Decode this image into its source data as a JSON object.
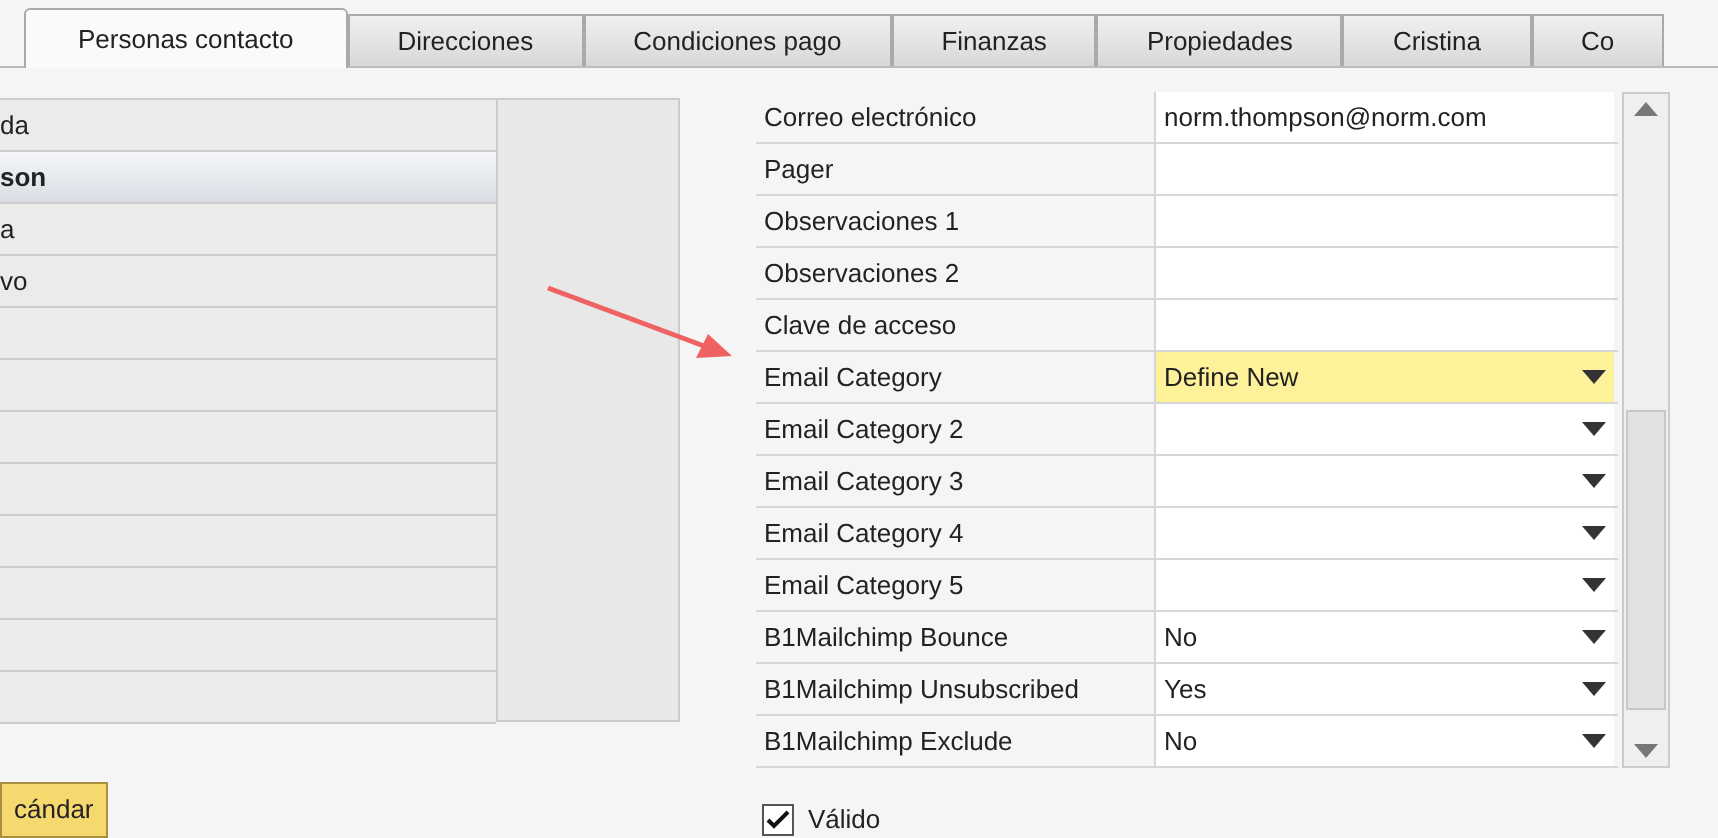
{
  "tabs": [
    {
      "label": "Personas contacto",
      "selected": true
    },
    {
      "label": "Direcciones",
      "selected": false
    },
    {
      "label": "Condiciones pago",
      "selected": false
    },
    {
      "label": "Finanzas",
      "selected": false
    },
    {
      "label": "Propiedades",
      "selected": false
    },
    {
      "label": "Cristina",
      "selected": false
    },
    {
      "label": "Co",
      "selected": false
    }
  ],
  "contacts": [
    {
      "name": "da",
      "selected": false
    },
    {
      "name": "son",
      "selected": true
    },
    {
      "name": "a",
      "selected": false
    },
    {
      "name": "vo",
      "selected": false
    }
  ],
  "fields": [
    {
      "label": "Correo electrónico",
      "kind": "text",
      "value": "norm.thompson@norm.com",
      "highlighted": false
    },
    {
      "label": "Pager",
      "kind": "text",
      "highlighted": false
    },
    {
      "label": "Observaciones 1",
      "kind": "text",
      "highlighted": false
    },
    {
      "label": "Observaciones 2",
      "kind": "text",
      "highlighted": false
    },
    {
      "label": "Clave de acceso",
      "kind": "text",
      "highlighted": false
    },
    {
      "label": "Email Category",
      "kind": "dropdown",
      "value": "Define New",
      "highlighted": true
    },
    {
      "label": "Email Category 2",
      "kind": "dropdown",
      "highlighted": false
    },
    {
      "label": "Email Category 3",
      "kind": "dropdown",
      "highlighted": false
    },
    {
      "label": "Email Category 4",
      "kind": "dropdown",
      "highlighted": false
    },
    {
      "label": "Email Category 5",
      "kind": "dropdown",
      "highlighted": false
    },
    {
      "label": "B1Mailchimp Bounce",
      "kind": "dropdown",
      "value": "No",
      "highlighted": false
    },
    {
      "label": "B1Mailchimp Unsubscribed",
      "kind": "dropdown",
      "value": "Yes",
      "highlighted": false
    },
    {
      "label": "B1Mailchimp Exclude",
      "kind": "dropdown",
      "value": "No",
      "highlighted": false
    }
  ],
  "valid": {
    "label": "Válido",
    "checked": true
  },
  "button": {
    "label": "cándar"
  }
}
